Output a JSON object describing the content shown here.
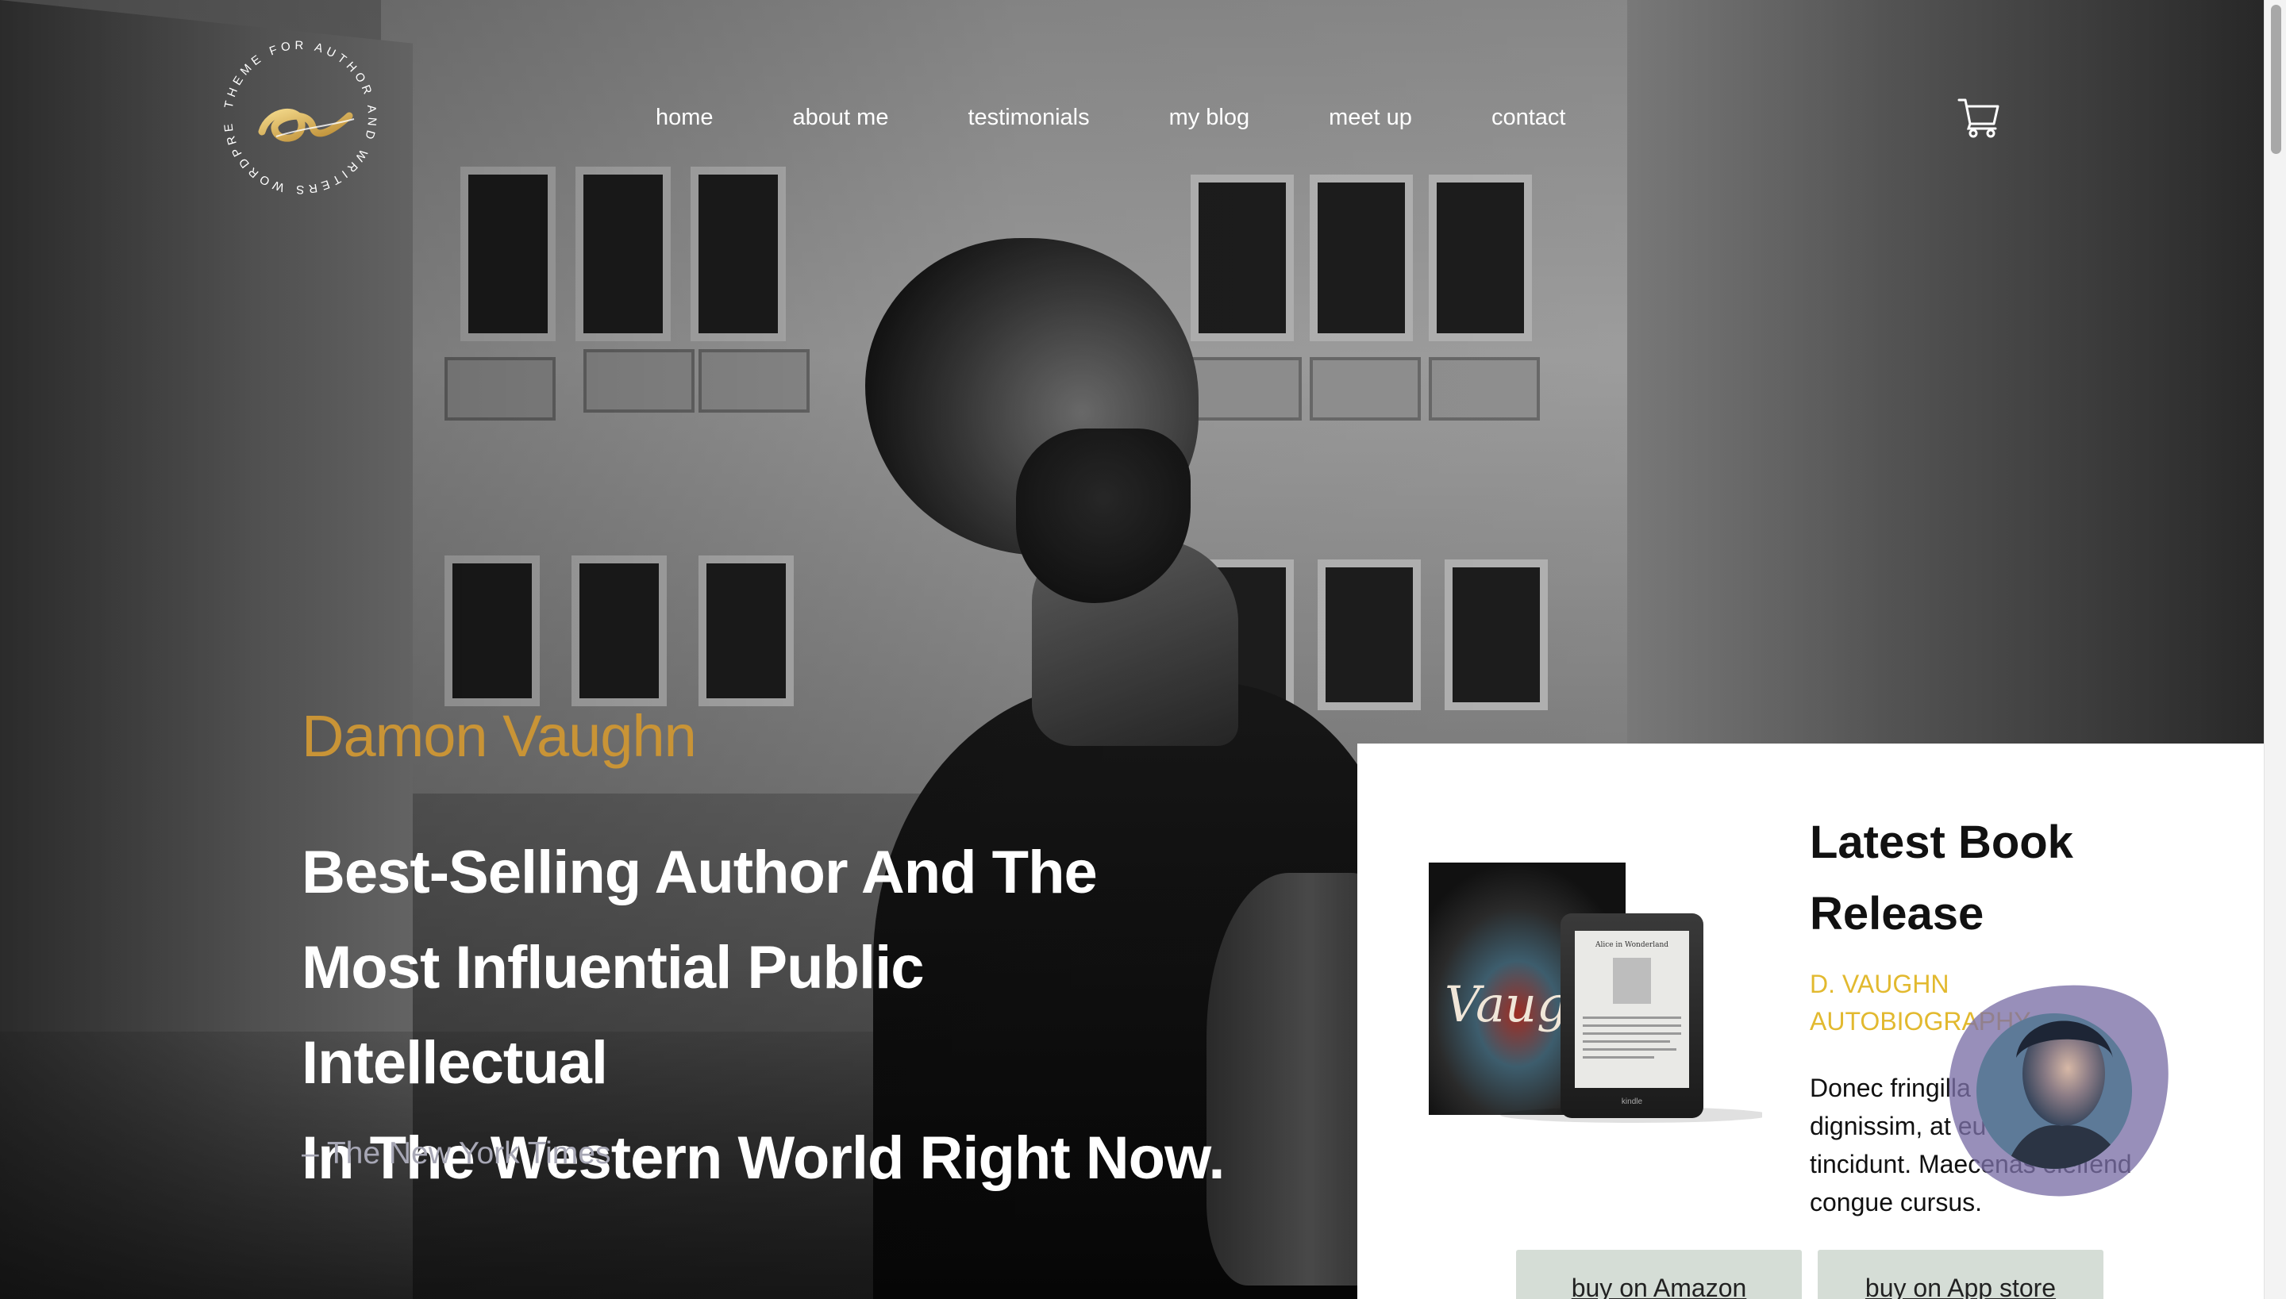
{
  "header": {
    "logo_ring_text": "THEME FOR AUTHOR AND WRITERS WORDPRESS",
    "logo_mark": "a",
    "nav": [
      {
        "label": "home"
      },
      {
        "label": "about me"
      },
      {
        "label": "testimonials"
      },
      {
        "label": "my blog"
      },
      {
        "label": "meet up"
      },
      {
        "label": "contact"
      }
    ],
    "cart_icon": "cart-icon"
  },
  "hero": {
    "name": "Damon Vaughn",
    "tagline_lines": [
      "Best-Selling Author And The",
      "Most Influential Public Intellectual",
      "In The Western World Right Now."
    ],
    "attribution": "– The New York Times",
    "name_color": "#c99436"
  },
  "book": {
    "title_lines": [
      "Latest Book",
      "Release"
    ],
    "subtitle_lines": [
      "D. VAUGHN",
      "AUTOBIOGRAPHY"
    ],
    "description_lines": [
      "Donec fringilla ... s",
      "dignissim, at eu ... n",
      "tincidunt. Maecenas eleifend",
      "congue cursus."
    ],
    "cover_word": "Vaughn",
    "ereader_title": "Alice in Wonderland",
    "ereader_brand": "kindle",
    "buttons": {
      "amazon": "buy on Amazon",
      "app_store": "buy on App store"
    },
    "accent_color": "#e2b92f"
  }
}
